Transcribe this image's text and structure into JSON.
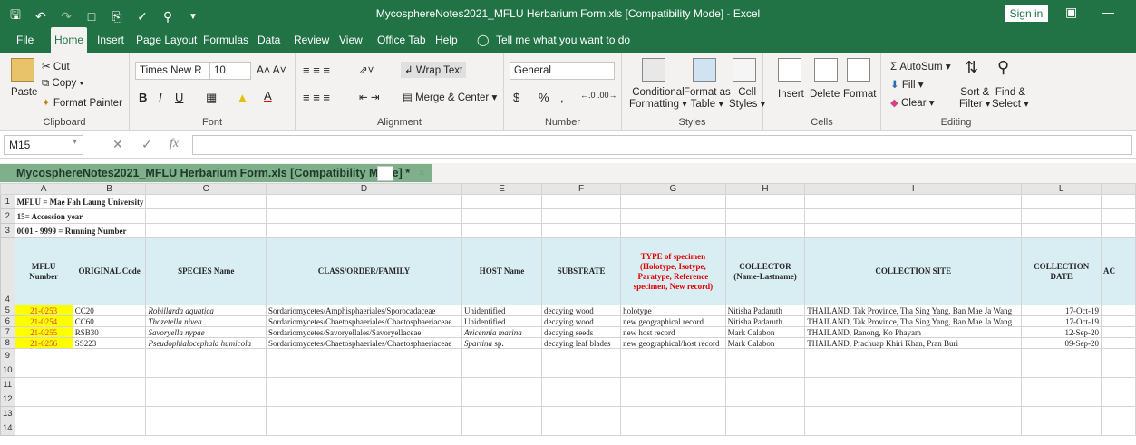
{
  "window": {
    "title": "MycosphereNotes2021_MFLU Herbarium Form.xls  [Compatibility Mode]  -  Excel",
    "signin": "Sign in"
  },
  "tabs": [
    "File",
    "Home",
    "Insert",
    "Page Layout",
    "Formulas",
    "Data",
    "Review",
    "View",
    "Office Tab",
    "Help"
  ],
  "tell_me": "Tell me what you want to do",
  "ribbon": {
    "clipboard": {
      "paste": "Paste",
      "cut": "Cut",
      "copy": "Copy",
      "format_painter": "Format Painter",
      "label": "Clipboard"
    },
    "font": {
      "name": "Times New R",
      "size": "10",
      "label": "Font",
      "bold": "B",
      "italic": "I",
      "underline": "U"
    },
    "alignment": {
      "wrap": "Wrap Text",
      "merge": "Merge & Center",
      "label": "Alignment"
    },
    "number": {
      "format": "General",
      "currency": "$",
      "percent": "%",
      "comma": ",",
      "label": "Number"
    },
    "styles": {
      "conditional": "Conditional",
      "conditional2": "Formatting",
      "format_as": "Format as",
      "format_as2": "Table",
      "cell": "Cell",
      "cell2": "Styles",
      "label": "Styles"
    },
    "cells": {
      "insert": "Insert",
      "delete": "Delete",
      "format": "Format",
      "label": "Cells"
    },
    "editing": {
      "autosum": "AutoSum",
      "fill": "Fill",
      "clear": "Clear",
      "sort": "Sort &",
      "sort2": "Filter",
      "find": "Find &",
      "find2": "Select",
      "label": "Editing"
    }
  },
  "formula": {
    "namebox": "M15",
    "fx": "fx",
    "value": ""
  },
  "workbook_tab": "MycosphereNotes2021_MFLU Herbarium Form.xls  [Compatibility Mode] *",
  "columns": [
    "A",
    "B",
    "C",
    "D",
    "E",
    "F",
    "G",
    "H",
    "I",
    "L"
  ],
  "rows": {
    "r1": "MFLU = Mae Fah Laung University",
    "r2": "15= Accession year",
    "r3": "0001 - 9999 = Running Number"
  },
  "headers": {
    "a": "MFLU Number",
    "b": "ORIGINAL Code",
    "c": "SPECIES Name",
    "d": "CLASS/ORDER/FAMILY",
    "e": "HOST Name",
    "f": "SUBSTRATE",
    "g": "TYPE of specimen (Holotype, Isotype, Paratype, Reference specimen, New record)",
    "h": "COLLECTOR (Name-Lastname)",
    "i": "COLLECTION SITE",
    "l": "COLLECTION DATE",
    "m": "AC"
  },
  "records": [
    {
      "num": "21-0253",
      "code": "CC20",
      "species": "Robillarda aquatica",
      "cls": "Sordariomycetes/Amphisphaeriales/Sporocadaceae",
      "host": "Unidentified",
      "sub": "decaying wood",
      "type": "holotype",
      "coll": "Nitisha Padaruth",
      "site": "THAILAND, Tak Province, Tha Sing Yang, Ban Mae Ja Wang",
      "date": "17-Oct-19"
    },
    {
      "num": "21-0254",
      "code": "CC60",
      "species": "Thozetella nivea",
      "cls": "Sordariomycetes/Chaetosphaeriales/Chaetosphaeriaceae",
      "host": "Unidentified",
      "sub": "decaying wood",
      "type": "new geographical record",
      "coll": "Nitisha Padaruth",
      "site": "THAILAND, Tak Province, Tha Sing Yang, Ban Mae Ja Wang",
      "date": "17-Oct-19"
    },
    {
      "num": "21-0255",
      "code": "RSB30",
      "species": "Savoryella nypae",
      "cls": "Sordariomycetes/Savoryellales/Savoryellaceae",
      "host": "Avicennia marina",
      "sub": "decaying seeds",
      "type": "new host record",
      "coll": "Mark Calabon",
      "site": "THAILAND, Ranong, Ko Phayam",
      "date": "12-Sep-20"
    },
    {
      "num": "21-0256",
      "code": "SS223",
      "species": "Pseudophialocephala humicola",
      "cls": "Sordariomycetes/Chaetosphaeriales/Chaetosphaeriaceae",
      "host": "Spartina",
      "host_suffix": "sp.",
      "sub": "decaying leaf blades",
      "type": "new geographical/host record",
      "coll": "Mark Calabon",
      "site": "THAILAND, Prachuap Khiri Khan, Pran Buri",
      "date": "09-Sep-20"
    }
  ],
  "row_numbers": [
    "1",
    "2",
    "3",
    "4",
    "5",
    "6",
    "7",
    "8",
    "9",
    "10",
    "11",
    "12",
    "13",
    "14"
  ],
  "colors": {
    "brand": "#217346",
    "header_fill": "#d9eef3",
    "highlight": "#ffff00",
    "type_red": "#e00000"
  }
}
